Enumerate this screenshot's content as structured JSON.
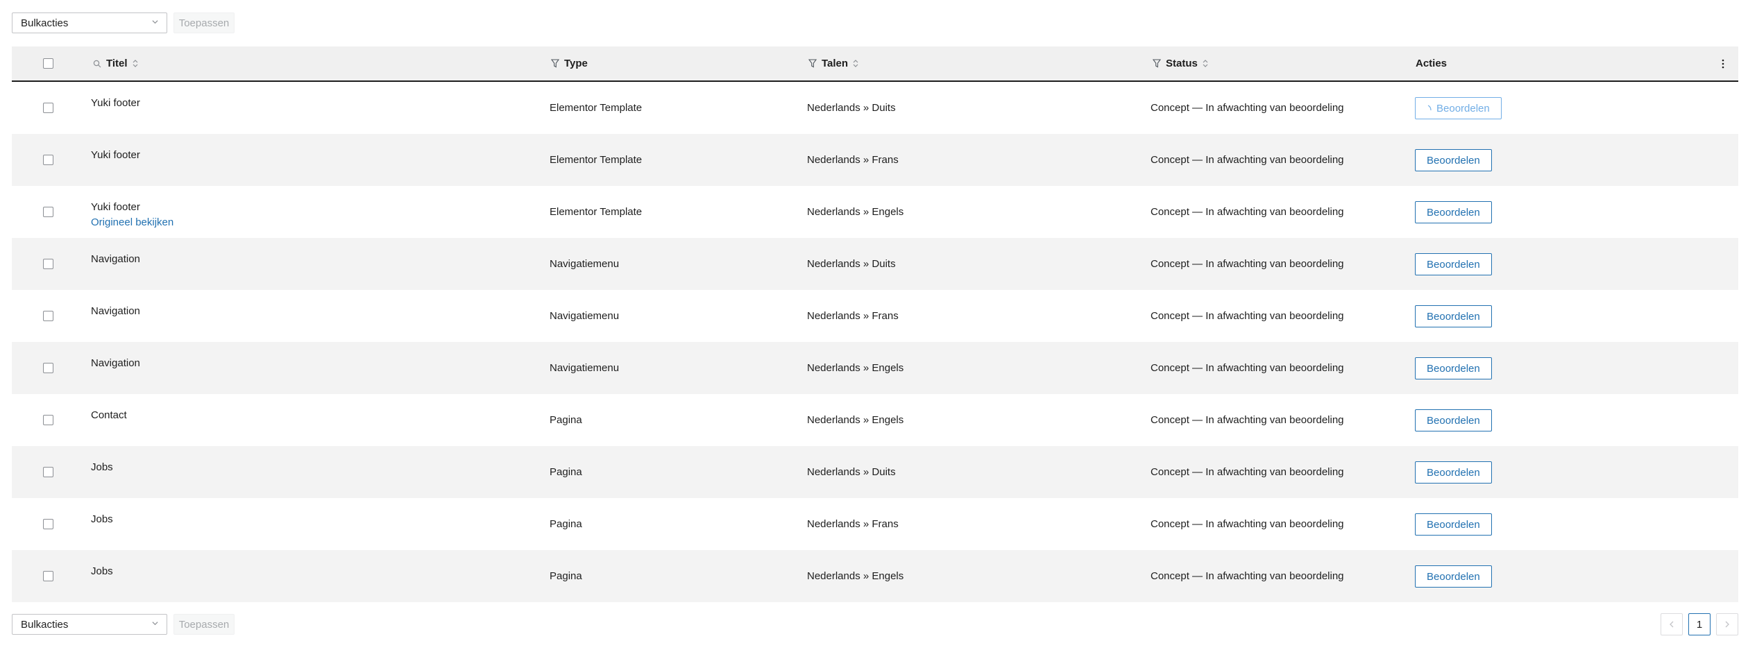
{
  "bulk": {
    "select_value": "Bulkacties",
    "apply_label": "Toepassen"
  },
  "headers": {
    "title": "Titel",
    "type": "Type",
    "languages": "Talen",
    "status": "Status",
    "actions": "Acties"
  },
  "rows": [
    {
      "title": "Yuki footer",
      "link": "",
      "type": "Elementor Template",
      "languages": "Nederlands » Duits",
      "status": "Concept — In afwachting van beoordeling",
      "action": "Beoordelen",
      "loading": true
    },
    {
      "title": "Yuki footer",
      "link": "",
      "type": "Elementor Template",
      "languages": "Nederlands » Frans",
      "status": "Concept — In afwachting van beoordeling",
      "action": "Beoordelen",
      "loading": false
    },
    {
      "title": "Yuki footer",
      "link": "Origineel bekijken",
      "type": "Elementor Template",
      "languages": "Nederlands » Engels",
      "status": "Concept — In afwachting van beoordeling",
      "action": "Beoordelen",
      "loading": false
    },
    {
      "title": "Navigation",
      "link": "",
      "type": "Navigatiemenu",
      "languages": "Nederlands » Duits",
      "status": "Concept — In afwachting van beoordeling",
      "action": "Beoordelen",
      "loading": false
    },
    {
      "title": "Navigation",
      "link": "",
      "type": "Navigatiemenu",
      "languages": "Nederlands » Frans",
      "status": "Concept — In afwachting van beoordeling",
      "action": "Beoordelen",
      "loading": false
    },
    {
      "title": "Navigation",
      "link": "",
      "type": "Navigatiemenu",
      "languages": "Nederlands » Engels",
      "status": "Concept — In afwachting van beoordeling",
      "action": "Beoordelen",
      "loading": false
    },
    {
      "title": "Contact",
      "link": "",
      "type": "Pagina",
      "languages": "Nederlands » Engels",
      "status": "Concept — In afwachting van beoordeling",
      "action": "Beoordelen",
      "loading": false
    },
    {
      "title": "Jobs",
      "link": "",
      "type": "Pagina",
      "languages": "Nederlands » Duits",
      "status": "Concept — In afwachting van beoordeling",
      "action": "Beoordelen",
      "loading": false
    },
    {
      "title": "Jobs",
      "link": "",
      "type": "Pagina",
      "languages": "Nederlands » Frans",
      "status": "Concept — In afwachting van beoordeling",
      "action": "Beoordelen",
      "loading": false
    },
    {
      "title": "Jobs",
      "link": "",
      "type": "Pagina",
      "languages": "Nederlands » Engels",
      "status": "Concept — In afwachting van beoordeling",
      "action": "Beoordelen",
      "loading": false
    }
  ],
  "pagination": {
    "current_page": "1"
  },
  "colors": {
    "accent": "#2271b1",
    "header_bg": "#f0f0f0",
    "row_alt_bg": "#f3f3f3"
  }
}
